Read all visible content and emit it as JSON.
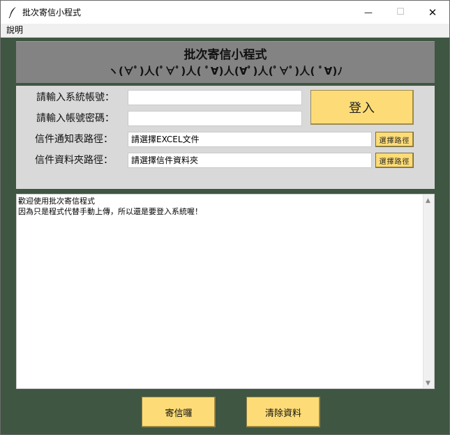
{
  "window": {
    "title": "批次寄信小程式",
    "minimize": "—",
    "maximize": "☐",
    "close": "✕"
  },
  "menu": {
    "help_label": "說明"
  },
  "header": {
    "title": "批次寄信小程式",
    "decoration": "ヽ(∀ﾟ)人(ﾟ∀ﾟ)人( ﾟ∀)人(∀ﾟ)人(ﾟ∀ﾟ)人( ﾟ∀)ﾉ"
  },
  "form": {
    "account_label": "請輸入系統帳號：",
    "account_value": "",
    "password_label": "請輸入帳號密碼：",
    "password_value": "",
    "notice_path_label": "信件通知表路徑：",
    "notice_path_value": "請選擇EXCEL文件",
    "folder_path_label": "信件資料夾路徑：",
    "folder_path_value": "請選擇信件資料夾",
    "choose_path_label": "選擇路徑",
    "login_label": "登入"
  },
  "log": {
    "lines": "歡迎使用批次寄信程式\n因為只是程式代替手動上傳，所以還是要登入系統喔！"
  },
  "buttons": {
    "send_label": "寄信囉",
    "clear_label": "清除資料"
  },
  "colors": {
    "window_bg": "#3f5642",
    "header_bg": "#838383",
    "panel_bg": "#d9d9d9",
    "button_bg": "#fddc77"
  },
  "icons": {
    "app": "feather-icon",
    "scroll_up": "triangle-up-icon",
    "scroll_down": "triangle-down-icon"
  }
}
